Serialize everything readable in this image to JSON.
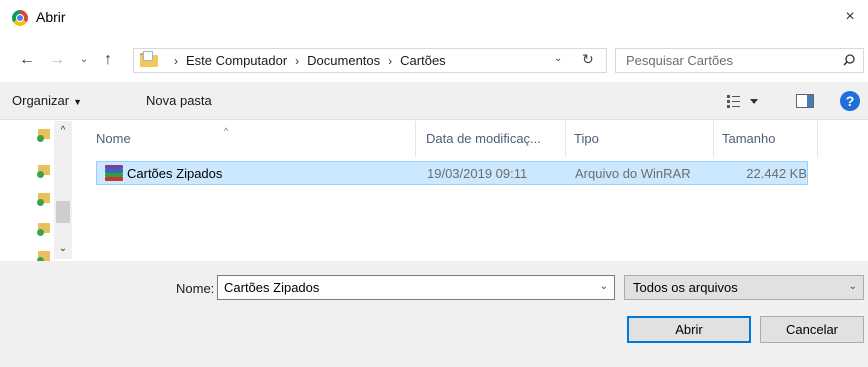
{
  "window": {
    "title": "Abrir",
    "close_glyph": "×",
    "icon": "chrome-icon"
  },
  "nav": {
    "back_glyph": "←",
    "forward_glyph": "→",
    "recent_glyph": "⌄",
    "up_glyph": "↑",
    "breadcrumbs": [
      "Este Computador",
      "Documentos",
      "Cartões"
    ],
    "crumb_sep": "›",
    "dropdown_glyph": "⌄",
    "refresh_glyph": "↻"
  },
  "search": {
    "placeholder": "Pesquisar Cartões"
  },
  "toolbar": {
    "organize_label": "Organizar",
    "organize_caret": "▼",
    "new_folder_label": "Nova pasta",
    "help_glyph": "?"
  },
  "columns": {
    "name": "Nome",
    "date": "Data de modificaç...",
    "type": "Tipo",
    "size": "Tamanho",
    "sort_glyph": "^"
  },
  "files": [
    {
      "name": "Cartões Zipados",
      "date": "19/03/2019 09:11",
      "type": "Arquivo do WinRAR",
      "size": "22.442 KB",
      "selected": true
    }
  ],
  "navpane": {
    "up_glyph": "^",
    "down_glyph": "⌄"
  },
  "footer": {
    "filename_label": "Nome:",
    "filename_value": "Cartões Zipados",
    "filetype_value": "Todos os arquivos",
    "caret_glyph": "⌄",
    "open_label": "Abrir",
    "cancel_label": "Cancelar"
  },
  "colors": {
    "selection_bg": "#cce8ff",
    "selection_border": "#99d1ff",
    "accent": "#0078d7"
  }
}
